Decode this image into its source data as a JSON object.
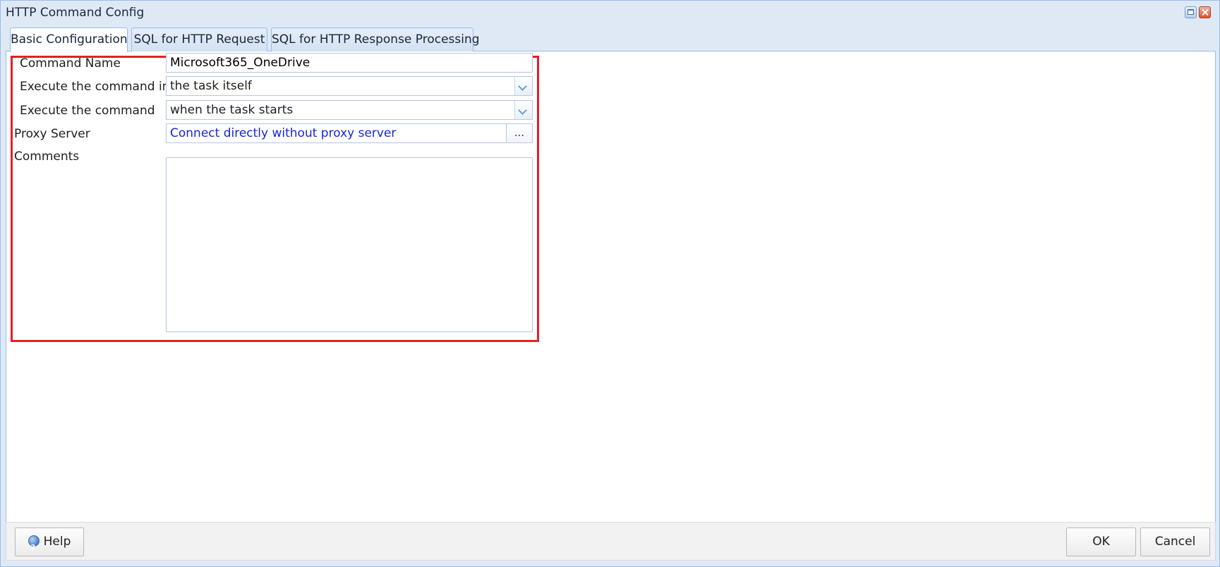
{
  "window": {
    "title": "HTTP Command Config"
  },
  "tabs": [
    {
      "label": "Basic Configuration",
      "active": true
    },
    {
      "label": "SQL for HTTP Request",
      "active": false
    },
    {
      "label": "SQL for HTTP Response Processing",
      "active": false
    }
  ],
  "form": {
    "command_name": {
      "label": "Command Name",
      "value": "Microsoft365_OneDrive"
    },
    "execute_in": {
      "label": "Execute the command in",
      "value": "the task itself"
    },
    "execute_when": {
      "label": "Execute the command",
      "value": "when the task starts"
    },
    "proxy_server": {
      "label": "Proxy Server",
      "value": "Connect directly without proxy server",
      "button": "...",
      "value_color": "#1a24d8"
    },
    "comments": {
      "label": "Comments",
      "value": ""
    }
  },
  "footer": {
    "help_label": "Help",
    "ok_label": "OK",
    "cancel_label": "Cancel"
  },
  "colors": {
    "highlight_border": "#e3202a",
    "window_chrome": "#dfe9f6",
    "border": "#99bbe8"
  },
  "icons": {
    "maximize": "maximize-icon",
    "close": "close-icon",
    "help": "help-icon",
    "dropdown": "chevron-down-icon"
  }
}
